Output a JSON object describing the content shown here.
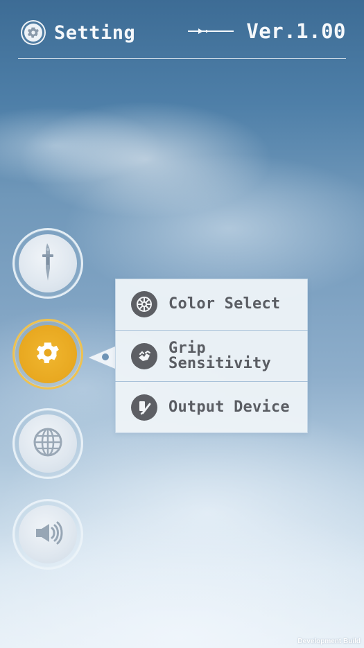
{
  "header": {
    "title": "Setting",
    "version": "Ver.1.00",
    "icons": {
      "settings": "gear-icon",
      "arrow": "arrow-right-icon"
    }
  },
  "sidebar": {
    "items": [
      {
        "name": "weapon",
        "icon": "sword-icon",
        "state": "inactive"
      },
      {
        "name": "settings",
        "icon": "gear-icon",
        "state": "active"
      },
      {
        "name": "language",
        "icon": "globe-icon",
        "state": "inactive"
      },
      {
        "name": "sound",
        "icon": "speaker-icon",
        "state": "inactive"
      }
    ]
  },
  "submenu": {
    "items": [
      {
        "label": "Color Select",
        "icon": "color-wheel-icon"
      },
      {
        "label": "Grip Sensitivity",
        "icon": "grip-icon"
      },
      {
        "label": "Output Device",
        "icon": "output-device-icon"
      }
    ]
  },
  "footer": {
    "build_label": "Development Build"
  },
  "colors": {
    "accent": "#E8A820",
    "menu_text": "#5A5D63",
    "menu_bg": "#EEF3F8",
    "header_text": "#F5F8FB"
  }
}
